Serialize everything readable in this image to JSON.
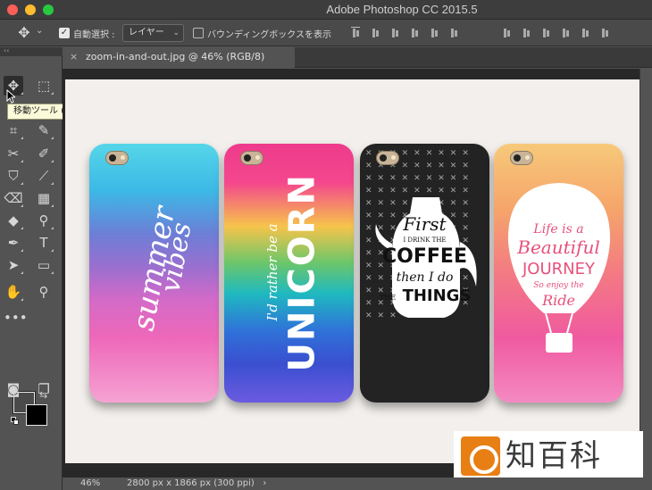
{
  "app": {
    "title": "Adobe Photoshop CC 2015.5"
  },
  "options_bar": {
    "auto_select_label": "自動選択 :",
    "auto_select_target": "レイヤー",
    "bounding_box_label": "バウンディングボックスを表示"
  },
  "document": {
    "tab_title": "zoom-in-and-out.jpg @ 46% (RGB/8)",
    "close_glyph": "×"
  },
  "tools_panel": {
    "collapse_glyph": "‹‹",
    "tooltip": "移動ツール (V)"
  },
  "status_bar": {
    "zoom": "46%",
    "doc_info": "2800 px x 1866 px (300 ppi)",
    "arrow": "›"
  },
  "canvas": {
    "phones": [
      {
        "lines": [
          "summer",
          "vibes"
        ]
      },
      {
        "lines": [
          "I'd rather be a",
          "UNICORN"
        ]
      },
      {
        "lines": [
          "First",
          "I DRINK THE",
          "COFFEE",
          "then I do",
          "THE",
          "THINGS"
        ]
      },
      {
        "lines": [
          "Life is a",
          "Beautiful",
          "JOURNEY",
          "So enjoy the",
          "Ride"
        ]
      }
    ]
  },
  "watermark": {
    "text": "知百科"
  },
  "colors": {
    "window_bg": "#535353",
    "canvas_bg": "#282828",
    "tooltip_bg": "#fbfbd9"
  }
}
